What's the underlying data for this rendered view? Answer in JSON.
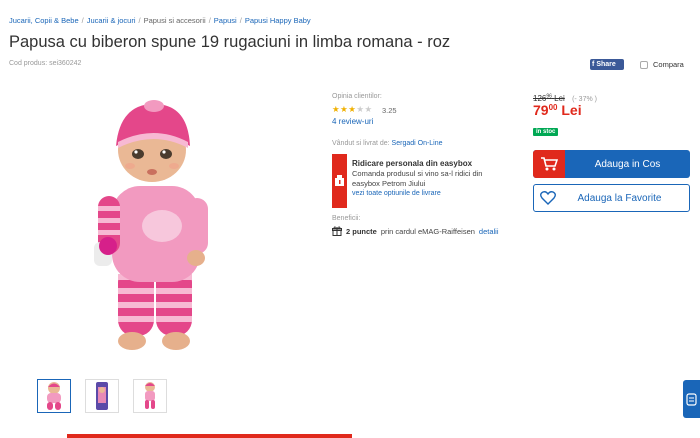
{
  "breadcrumb": {
    "items": [
      "Jucarii, Copii & Bebe",
      "Jucarii & jocuri",
      "Papusi si accesorii",
      "Papusi",
      "Papusi Happy Baby"
    ],
    "separator": "/"
  },
  "product": {
    "title": "Papusa cu biberon spune 19 rugaciuni in limba romana - roz",
    "code": "Cod produs: sei360242"
  },
  "actions": {
    "share_label": "Share",
    "compare_label": "Compara"
  },
  "rating": {
    "label": "Opinia clientilor:",
    "value": "3.25",
    "stars_filled": 3,
    "stars_total": 5,
    "reviews_label": "4 review-uri"
  },
  "seller": {
    "prefix": "Vândut si livrat de:",
    "name": "Sergadi On-Line"
  },
  "easybox": {
    "title": "Ridicare personala din easybox",
    "text": "Comanda produsul si vino sa-l ridici din easybox Petrom Jiului",
    "link": "vezi toate optiunile de livrare"
  },
  "benefits": {
    "label": "Beneficii:",
    "points": "2 puncte",
    "text": "prin cardul eMAG-Raiffeisen",
    "link": "detalii"
  },
  "price": {
    "old": "126",
    "old_decimals": "96",
    "old_currency": "Lei",
    "discount": "(- 37% )",
    "new": "79",
    "new_decimals": "00",
    "currency": "Lei",
    "stock": "în stoc"
  },
  "buttons": {
    "add_to_cart": "Adauga in Cos",
    "add_to_favorites": "Adauga la Favorite"
  },
  "colors": {
    "brand_blue": "#1a66b8",
    "accent_red": "#e0291c",
    "stock_green": "#00a854",
    "doll_pink": "#f29ac0",
    "stripe_magenta": "#e4478a"
  },
  "icons": [
    "facebook-icon",
    "checkbox-icon",
    "star-icon",
    "easybox-icon",
    "gift-icon",
    "cart-icon",
    "heart-icon",
    "chat-icon"
  ]
}
